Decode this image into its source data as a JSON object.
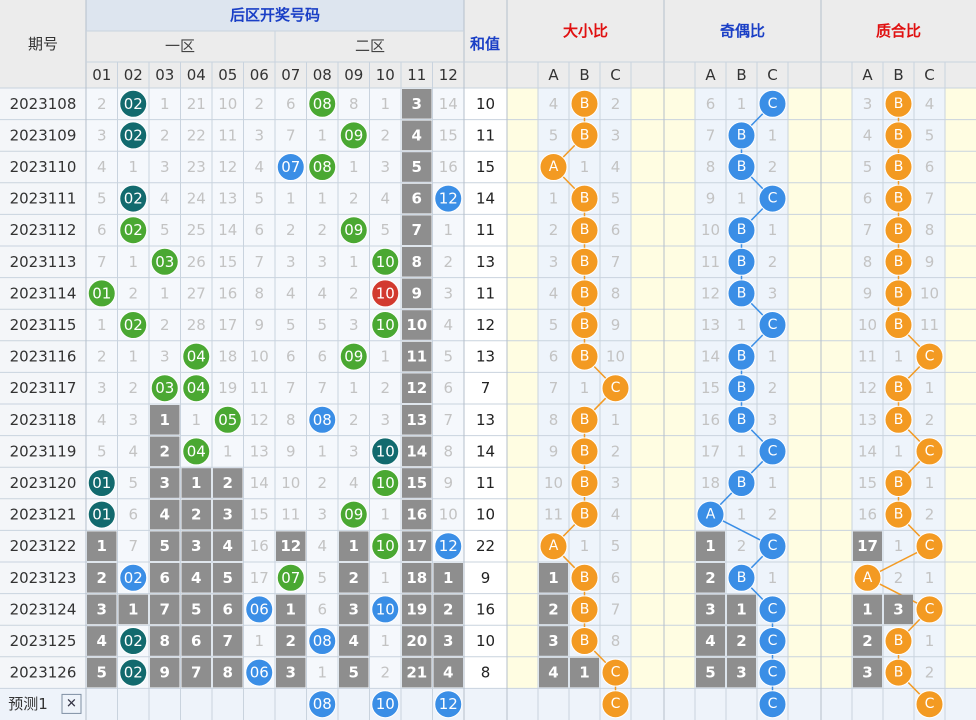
{
  "headers": {
    "period": "期号",
    "back_area": "后区开奖号码",
    "zone1": "一区",
    "zone2": "二区",
    "sum": "和值",
    "size_ratio": "大小比",
    "odd_even_ratio": "奇偶比",
    "prime_ratio": "质合比"
  },
  "number_labels": [
    "01",
    "02",
    "03",
    "04",
    "05",
    "06",
    "07",
    "08",
    "09",
    "10",
    "11",
    "12"
  ],
  "ratio_labels": [
    "A",
    "B",
    "C"
  ],
  "predict_label": "预测1",
  "predict_close_glyph": "✕",
  "colors": {
    "green": "#4aa832",
    "teal": "#126a6e",
    "blue": "#3a8ee6",
    "red": "#d23a2f",
    "orange": "#f39a22",
    "gray": "#8e8e8e",
    "header_title_blue": "#1a3fc6",
    "header_title_red": "#e01010"
  },
  "chart_data": {
    "type": "table",
    "periods": [
      "2023108",
      "2023109",
      "2023110",
      "2023111",
      "2023112",
      "2023113",
      "2023114",
      "2023115",
      "2023116",
      "2023117",
      "2023118",
      "2023119",
      "2023120",
      "2023121",
      "2023122",
      "2023123",
      "2023124",
      "2023125",
      "2023126"
    ],
    "draws": [
      {
        "missing": [
          "2",
          "",
          "1",
          "21",
          "10",
          "2",
          "6",
          "",
          "8",
          "1",
          "3",
          "14"
        ],
        "hits": [
          [
            1,
            "teal"
          ],
          [
            7,
            "green"
          ]
        ],
        "sum": "10"
      },
      {
        "missing": [
          "3",
          "",
          "2",
          "22",
          "11",
          "3",
          "7",
          "1",
          "",
          "2",
          "4",
          "15"
        ],
        "hits": [
          [
            1,
            "teal"
          ],
          [
            8,
            "green"
          ]
        ],
        "sum": "11"
      },
      {
        "missing": [
          "4",
          "1",
          "3",
          "23",
          "12",
          "4",
          "",
          "",
          "1",
          "3",
          "5",
          "16"
        ],
        "hits": [
          [
            6,
            "blue"
          ],
          [
            7,
            "green"
          ]
        ],
        "sum": "15"
      },
      {
        "missing": [
          "5",
          "",
          "4",
          "24",
          "13",
          "5",
          "1",
          "1",
          "2",
          "4",
          "6",
          ""
        ],
        "hits": [
          [
            1,
            "teal"
          ],
          [
            11,
            "blue"
          ]
        ],
        "sum": "14"
      },
      {
        "missing": [
          "6",
          "",
          "5",
          "25",
          "14",
          "6",
          "2",
          "2",
          "",
          "5",
          "7",
          "1"
        ],
        "hits": [
          [
            1,
            "green"
          ],
          [
            8,
            "green"
          ]
        ],
        "sum": "11"
      },
      {
        "missing": [
          "7",
          "1",
          "",
          "26",
          "15",
          "7",
          "3",
          "3",
          "1",
          "",
          "8",
          "2"
        ],
        "hits": [
          [
            2,
            "green"
          ],
          [
            9,
            "green"
          ]
        ],
        "sum": "13"
      },
      {
        "missing": [
          "",
          "2",
          "1",
          "27",
          "16",
          "8",
          "4",
          "4",
          "2",
          "",
          "9",
          "3"
        ],
        "hits": [
          [
            0,
            "green"
          ],
          [
            9,
            "red"
          ]
        ],
        "sum": "11"
      },
      {
        "missing": [
          "1",
          "",
          "2",
          "28",
          "17",
          "9",
          "5",
          "5",
          "3",
          "",
          "10",
          "4"
        ],
        "hits": [
          [
            1,
            "green"
          ],
          [
            9,
            "green"
          ]
        ],
        "sum": "12"
      },
      {
        "missing": [
          "2",
          "1",
          "3",
          "",
          "18",
          "10",
          "6",
          "6",
          "",
          "1",
          "11",
          "5"
        ],
        "hits": [
          [
            3,
            "green"
          ],
          [
            8,
            "green"
          ]
        ],
        "sum": "13"
      },
      {
        "missing": [
          "3",
          "2",
          "",
          "",
          "19",
          "11",
          "7",
          "7",
          "1",
          "2",
          "12",
          "6"
        ],
        "hits": [
          [
            2,
            "green"
          ],
          [
            3,
            "green"
          ]
        ],
        "sum": "7"
      },
      {
        "missing": [
          "4",
          "3",
          "1",
          "1",
          "",
          "12",
          "8",
          "",
          "2",
          "3",
          "13",
          "7"
        ],
        "hits": [
          [
            4,
            "green"
          ],
          [
            7,
            "blue"
          ]
        ],
        "sum": "13"
      },
      {
        "missing": [
          "5",
          "4",
          "2",
          "",
          "1",
          "13",
          "9",
          "1",
          "3",
          "",
          "14",
          "8"
        ],
        "hits": [
          [
            3,
            "green"
          ],
          [
            9,
            "teal"
          ]
        ],
        "sum": "14"
      },
      {
        "missing": [
          "",
          "5",
          "3",
          "1",
          "2",
          "14",
          "10",
          "2",
          "4",
          "",
          "15",
          "9"
        ],
        "hits": [
          [
            0,
            "teal"
          ],
          [
            9,
            "green"
          ]
        ],
        "sum": "11"
      },
      {
        "missing": [
          "",
          "6",
          "4",
          "2",
          "3",
          "15",
          "11",
          "3",
          "",
          "1",
          "16",
          "10"
        ],
        "hits": [
          [
            0,
            "teal"
          ],
          [
            8,
            "green"
          ]
        ],
        "sum": "10"
      },
      {
        "missing": [
          "1",
          "7",
          "5",
          "3",
          "4",
          "16",
          "12",
          "4",
          "1",
          "",
          "17",
          ""
        ],
        "hits": [
          [
            9,
            "green"
          ],
          [
            11,
            "blue"
          ]
        ],
        "sum": "22"
      },
      {
        "missing": [
          "2",
          "",
          "6",
          "4",
          "5",
          "17",
          "",
          "5",
          "2",
          "1",
          "18",
          "1"
        ],
        "hits": [
          [
            1,
            "blue"
          ],
          [
            6,
            "green"
          ]
        ],
        "sum": "9"
      },
      {
        "missing": [
          "3",
          "1",
          "7",
          "5",
          "6",
          "",
          "1",
          "6",
          "3",
          "",
          "19",
          "2"
        ],
        "hits": [
          [
            5,
            "blue"
          ],
          [
            9,
            "blue"
          ]
        ],
        "sum": "16"
      },
      {
        "missing": [
          "4",
          "",
          "8",
          "6",
          "7",
          "1",
          "2",
          "",
          "4",
          "1",
          "20",
          "3"
        ],
        "hits": [
          [
            1,
            "teal"
          ],
          [
            7,
            "blue"
          ]
        ],
        "sum": "10"
      },
      {
        "missing": [
          "5",
          "",
          "9",
          "7",
          "8",
          "",
          "3",
          "1",
          "5",
          "2",
          "21",
          "4"
        ],
        "hits": [
          [
            1,
            "teal"
          ],
          [
            5,
            "blue"
          ]
        ],
        "sum": "8"
      }
    ],
    "predict_hits": [
      7,
      9,
      11
    ],
    "size_ratio": {
      "trend": [
        1,
        1,
        0,
        1,
        1,
        1,
        1,
        1,
        1,
        2,
        1,
        1,
        1,
        1,
        0,
        1,
        1,
        1,
        2
      ],
      "missing": [
        [
          "4",
          "",
          "2"
        ],
        [
          "5",
          "",
          "3"
        ],
        [
          "",
          "1",
          "4"
        ],
        [
          "1",
          "",
          "5"
        ],
        [
          "2",
          "",
          "6"
        ],
        [
          "3",
          "",
          "7"
        ],
        [
          "4",
          "",
          "8"
        ],
        [
          "5",
          "",
          "9"
        ],
        [
          "6",
          "",
          "10"
        ],
        [
          "7",
          "1",
          ""
        ],
        [
          "8",
          "",
          "1"
        ],
        [
          "9",
          "",
          "2"
        ],
        [
          "10",
          "",
          "3"
        ],
        [
          "11",
          "",
          "4"
        ],
        [
          "",
          "1",
          "5"
        ],
        [
          "1",
          "",
          "6"
        ],
        [
          "2",
          "",
          "7"
        ],
        [
          "3",
          "",
          "8"
        ],
        [
          "4",
          "1",
          ""
        ]
      ],
      "predict": [
        2
      ]
    },
    "odd_even_ratio": {
      "trend": [
        2,
        1,
        1,
        2,
        1,
        1,
        1,
        2,
        1,
        1,
        1,
        2,
        1,
        0,
        2,
        1,
        2,
        2,
        2
      ],
      "missing": [
        [
          "6",
          "1",
          ""
        ],
        [
          "7",
          "",
          "1"
        ],
        [
          "8",
          "",
          "2"
        ],
        [
          "9",
          "1",
          ""
        ],
        [
          "10",
          "",
          "1"
        ],
        [
          "11",
          "",
          "2"
        ],
        [
          "12",
          "",
          "3"
        ],
        [
          "13",
          "1",
          ""
        ],
        [
          "14",
          "",
          "1"
        ],
        [
          "15",
          "",
          "2"
        ],
        [
          "16",
          "",
          "3"
        ],
        [
          "17",
          "1",
          ""
        ],
        [
          "18",
          "",
          "1"
        ],
        [
          "",
          "1",
          "2"
        ],
        [
          "1",
          "2",
          ""
        ],
        [
          "2",
          "",
          "1"
        ],
        [
          "3",
          "1",
          ""
        ],
        [
          "4",
          "2",
          ""
        ],
        [
          "5",
          "3",
          ""
        ]
      ],
      "predict": [
        2
      ]
    },
    "prime_ratio": {
      "trend": [
        1,
        1,
        1,
        1,
        1,
        1,
        1,
        1,
        2,
        1,
        1,
        2,
        1,
        1,
        2,
        0,
        2,
        1,
        1
      ],
      "missing": [
        [
          "3",
          "",
          "4"
        ],
        [
          "4",
          "",
          "5"
        ],
        [
          "5",
          "",
          "6"
        ],
        [
          "6",
          "",
          "7"
        ],
        [
          "7",
          "",
          "8"
        ],
        [
          "8",
          "",
          "9"
        ],
        [
          "9",
          "",
          "10"
        ],
        [
          "10",
          "",
          "11"
        ],
        [
          "11",
          "1",
          ""
        ],
        [
          "12",
          "",
          "1"
        ],
        [
          "13",
          "",
          "2"
        ],
        [
          "14",
          "1",
          ""
        ],
        [
          "15",
          "",
          "1"
        ],
        [
          "16",
          "",
          "2"
        ],
        [
          "17",
          "1",
          ""
        ],
        [
          "",
          "2",
          "1"
        ],
        [
          "1",
          "3",
          ""
        ],
        [
          "2",
          "",
          "1"
        ],
        [
          "3",
          "",
          "2"
        ]
      ],
      "predict": [
        2
      ]
    }
  }
}
